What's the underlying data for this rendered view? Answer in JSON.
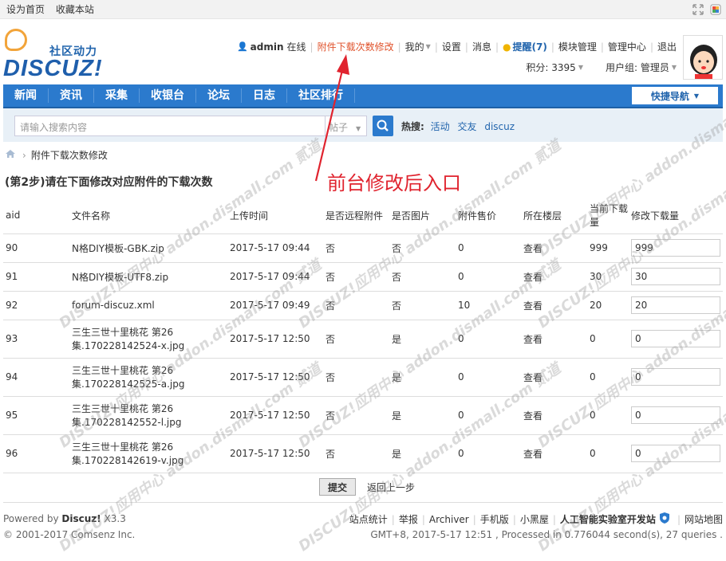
{
  "topbar": {
    "set_home": "设为首页",
    "bookmark": "收藏本站"
  },
  "logo": {
    "tagline": "社区动力",
    "brand": "DISCUZ!"
  },
  "userbar": {
    "username": "admin",
    "status": "在线",
    "attach_link": "附件下载次数修改",
    "mine": "我的",
    "settings": "设置",
    "messages": "消息",
    "remind": "提醒(7)",
    "module_admin": "模块管理",
    "admin_center": "管理中心",
    "logout": "退出",
    "credits": "积分: 3395",
    "usergroup": "用户组: 管理员"
  },
  "nav": {
    "items": [
      "新闻",
      "资讯",
      "采集",
      "收银台",
      "论坛",
      "日志",
      "社区排行"
    ],
    "quick": "快捷导航"
  },
  "search": {
    "placeholder": "请输入搜索内容",
    "type": "帖子",
    "hot_label": "热搜:",
    "hot_keywords": [
      "活动",
      "交友",
      "discuz"
    ]
  },
  "breadcrumb": {
    "current": "附件下载次数修改"
  },
  "step_title": "(第2步)请在下面修改对应附件的下载次数",
  "annotation": "前台修改后入口",
  "table": {
    "headers": [
      "aid",
      "文件名称",
      "上传时间",
      "是否远程附件",
      "是否图片",
      "附件售价",
      "所在楼层",
      "当前下载量",
      "修改下载量"
    ],
    "rows": [
      {
        "aid": "90",
        "name": "N格DIY模板-GBK.zip",
        "time": "2017-5-17 09:44",
        "remote": "否",
        "image": "否",
        "price": "0",
        "floor": "查看",
        "current": "999",
        "edit": "999"
      },
      {
        "aid": "91",
        "name": "N格DIY模板-UTF8.zip",
        "time": "2017-5-17 09:44",
        "remote": "否",
        "image": "否",
        "price": "0",
        "floor": "查看",
        "current": "30",
        "edit": "30"
      },
      {
        "aid": "92",
        "name": "forum-discuz.xml",
        "time": "2017-5-17 09:49",
        "remote": "否",
        "image": "否",
        "price": "10",
        "floor": "查看",
        "current": "20",
        "edit": "20"
      },
      {
        "aid": "93",
        "name": "三生三世十里桃花 第26集.170228142524-x.jpg",
        "time": "2017-5-17 12:50",
        "remote": "否",
        "image": "是",
        "price": "0",
        "floor": "查看",
        "current": "0",
        "edit": "0"
      },
      {
        "aid": "94",
        "name": "三生三世十里桃花 第26集.170228142525-a.jpg",
        "time": "2017-5-17 12:50",
        "remote": "否",
        "image": "是",
        "price": "0",
        "floor": "查看",
        "current": "0",
        "edit": "0"
      },
      {
        "aid": "95",
        "name": "三生三世十里桃花 第26集.170228142552-l.jpg",
        "time": "2017-5-17 12:50",
        "remote": "否",
        "image": "是",
        "price": "0",
        "floor": "查看",
        "current": "0",
        "edit": "0"
      },
      {
        "aid": "96",
        "name": "三生三世十里桃花 第26集.170228142619-v.jpg",
        "time": "2017-5-17 12:50",
        "remote": "否",
        "image": "是",
        "price": "0",
        "floor": "查看",
        "current": "0",
        "edit": "0"
      }
    ]
  },
  "actions": {
    "submit": "提交",
    "back": "返回上一步"
  },
  "footer": {
    "powered_prefix": "Powered by ",
    "powered_brand": "Discuz!",
    "powered_version": " X3.3",
    "copyright": "© 2001-2017 Comsenz Inc.",
    "links": [
      "站点统计",
      "举报",
      "Archiver",
      "手机版",
      "小黑屋"
    ],
    "lab": "人工智能实验室开发站",
    "sitemap": "网站地图",
    "stats": "GMT+8, 2017-5-17 12:51 , Processed in 0.776044 second(s), 27 queries ."
  },
  "watermark": "DISCUZ!应用中心 addon.dismall.com 贰道",
  "colors": {
    "nav_blue": "#2b7acd",
    "link_blue": "#2265ad",
    "annotation_red": "#e0232e",
    "attach_link_red": "#e0532c"
  }
}
